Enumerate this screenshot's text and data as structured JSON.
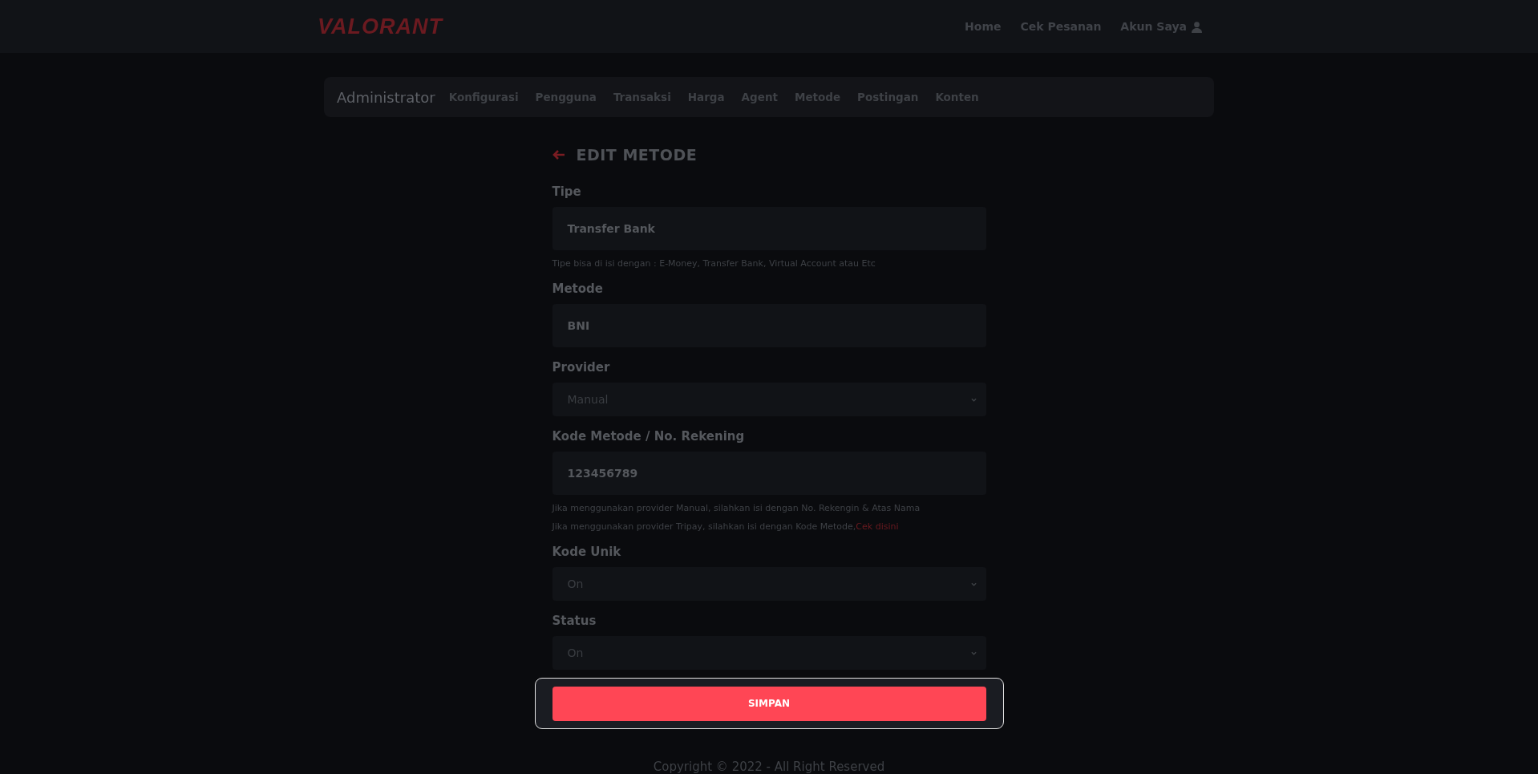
{
  "header": {
    "logo": "VALORANT",
    "nav": [
      "Home",
      "Cek Pesanan"
    ],
    "account": "Akun Saya"
  },
  "admin_bar": {
    "title": "Administrator",
    "items": [
      "Konfigurasi",
      "Pengguna",
      "Transaksi",
      "Harga",
      "Agent",
      "Metode",
      "Postingan",
      "Konten"
    ]
  },
  "form": {
    "title": "EDIT METODE",
    "fields": [
      {
        "kind": "input",
        "label": "Tipe",
        "value": "Transfer Bank",
        "help": [
          {
            "text": "Tipe bisa di isi dengan : E-Money, Transfer Bank, Virtual Account atau Etc"
          }
        ]
      },
      {
        "kind": "input",
        "label": "Metode",
        "value": "BNI"
      },
      {
        "kind": "select",
        "label": "Provider",
        "value": "Manual"
      },
      {
        "kind": "input",
        "label": "Kode Metode / No. Rekening",
        "value": "123456789",
        "help": [
          {
            "text": "Jika menggunakan provider Manual, silahkan isi dengan No. Rekengin & Atas Nama"
          },
          {
            "text": "Jika menggunakan provider Tripay, silahkan isi dengan Kode Metode,",
            "link": "Cek disini"
          }
        ]
      },
      {
        "kind": "select",
        "label": "Kode Unik",
        "value": "On"
      },
      {
        "kind": "select",
        "label": "Status",
        "value": "On"
      }
    ],
    "submit": "SIMPAN"
  },
  "footer": "Copyright © 2022 - All Right Reserved"
}
